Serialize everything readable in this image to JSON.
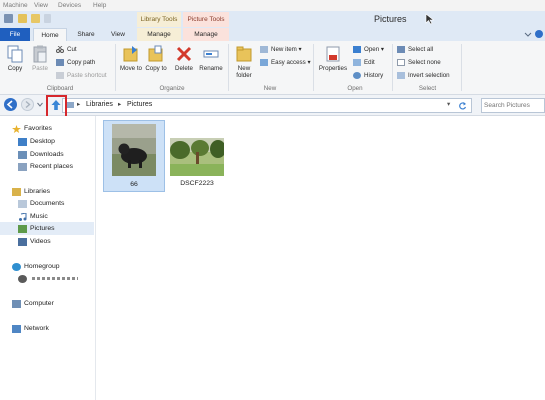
{
  "vm_menu": [
    "Machine",
    "View",
    "Devices",
    "Help"
  ],
  "window": {
    "title": "Pictures",
    "contextual_tabs": [
      "Library Tools",
      "Picture Tools"
    ]
  },
  "tabs": [
    "File",
    "Home",
    "Share",
    "View",
    "Manage",
    "Manage"
  ],
  "ribbon": {
    "clipboard": {
      "label": "Clipboard",
      "copy": "Copy",
      "paste": "Paste",
      "cut": "Cut",
      "copy_path": "Copy path",
      "paste_shortcut": "Paste shortcut"
    },
    "organize": {
      "label": "Organize",
      "move_to": "Move to",
      "copy_to": "Copy to",
      "delete": "Delete",
      "rename": "Rename"
    },
    "new": {
      "label": "New",
      "new_folder": "New folder",
      "new_item": "New item ▾",
      "easy_access": "Easy access ▾"
    },
    "open": {
      "label": "Open",
      "properties": "Properties",
      "open": "Open ▾",
      "edit": "Edit",
      "history": "History"
    },
    "select": {
      "label": "Select",
      "select_all": "Select all",
      "select_none": "Select none",
      "invert_selection": "Invert selection"
    }
  },
  "address": {
    "path": [
      "Libraries",
      "Pictures"
    ],
    "search_placeholder": "Search Pictures"
  },
  "nav": {
    "favorites": "Favorites",
    "favorites_items": [
      "Desktop",
      "Downloads",
      "Recent places"
    ],
    "libraries": "Libraries",
    "libraries_items": [
      "Documents",
      "Music",
      "Pictures",
      "Videos"
    ],
    "homegroup": "Homegroup",
    "computer": "Computer",
    "network": "Network"
  },
  "files": [
    {
      "name": "66"
    },
    {
      "name": "DSCF2223"
    }
  ],
  "colors": {
    "accent": "#1f5fbf",
    "highlight": "#d6272c",
    "selection": "#cde1f7"
  }
}
